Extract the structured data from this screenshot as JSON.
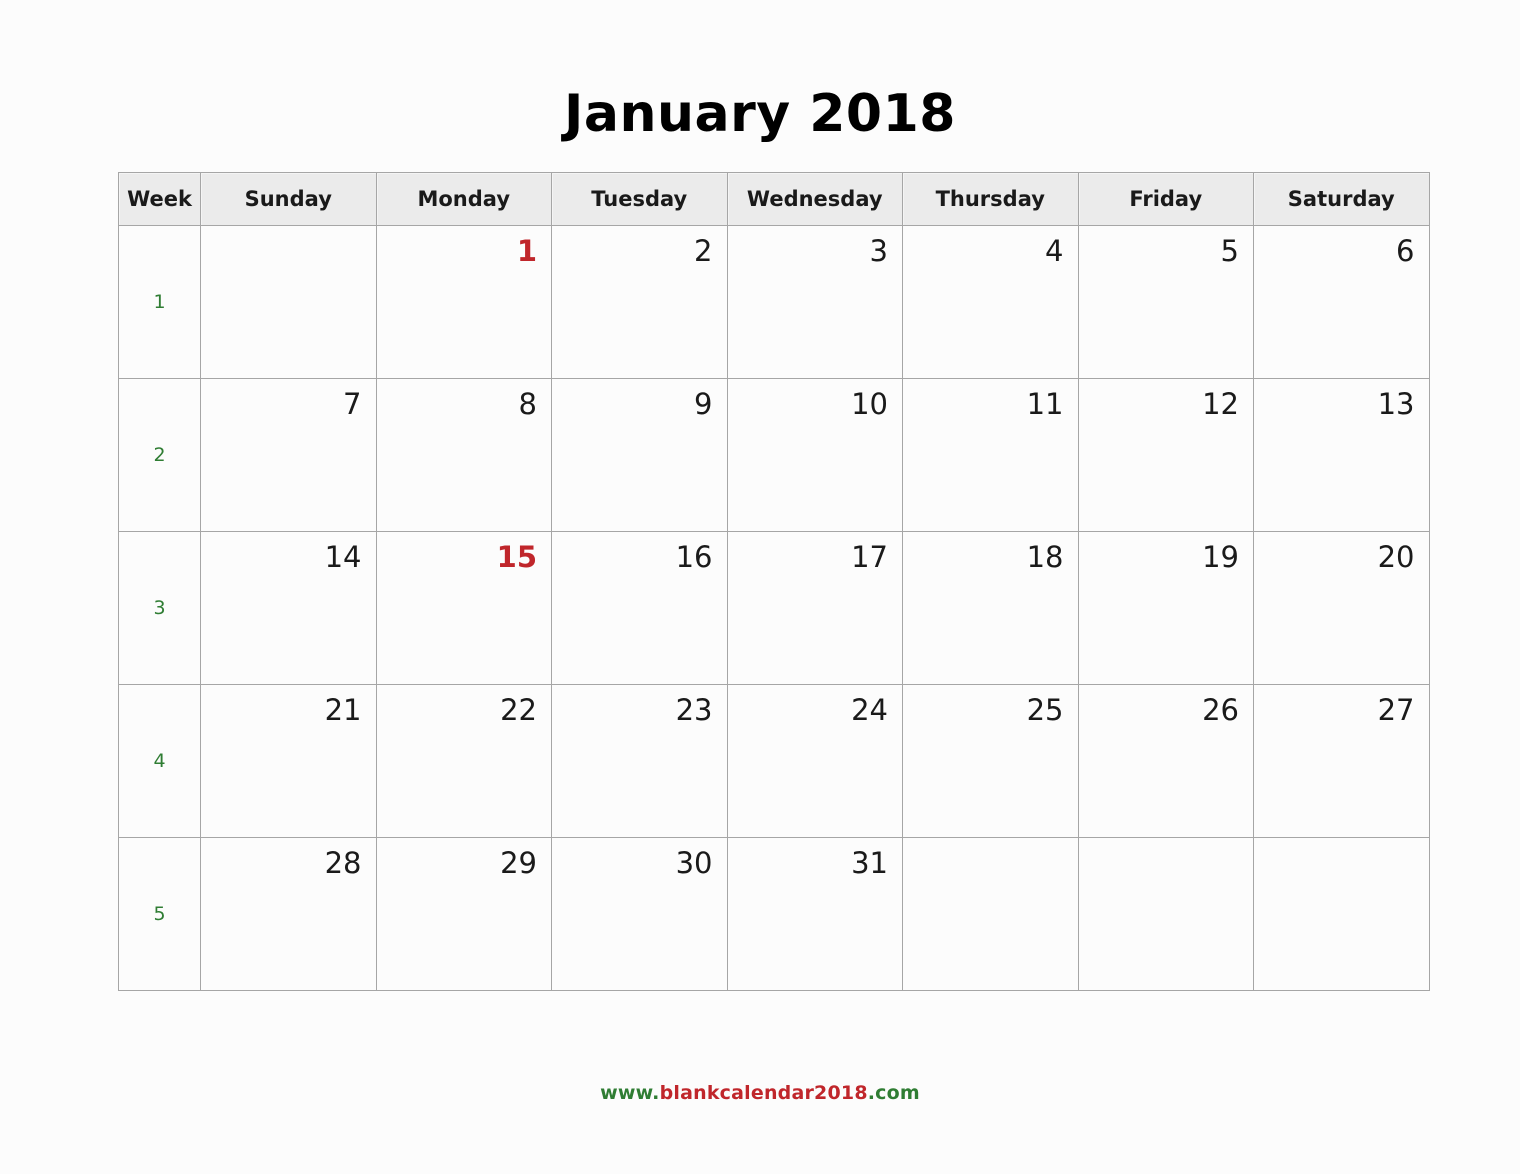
{
  "title": "January 2018",
  "colors": {
    "holiday": "#c0262b",
    "week_number": "#2f7d33",
    "header_bg": "#ebebeb",
    "border": "#a6a6a6",
    "text": "#1a1a1a"
  },
  "table": {
    "headers": [
      "Week",
      "Sunday",
      "Monday",
      "Tuesday",
      "Wednesday",
      "Thursday",
      "Friday",
      "Saturday"
    ],
    "rows": [
      {
        "week": "1",
        "days": [
          {
            "day": "",
            "holiday": false
          },
          {
            "day": "1",
            "holiday": true
          },
          {
            "day": "2",
            "holiday": false
          },
          {
            "day": "3",
            "holiday": false
          },
          {
            "day": "4",
            "holiday": false
          },
          {
            "day": "5",
            "holiday": false
          },
          {
            "day": "6",
            "holiday": false
          }
        ]
      },
      {
        "week": "2",
        "days": [
          {
            "day": "7",
            "holiday": false
          },
          {
            "day": "8",
            "holiday": false
          },
          {
            "day": "9",
            "holiday": false
          },
          {
            "day": "10",
            "holiday": false
          },
          {
            "day": "11",
            "holiday": false
          },
          {
            "day": "12",
            "holiday": false
          },
          {
            "day": "13",
            "holiday": false
          }
        ]
      },
      {
        "week": "3",
        "days": [
          {
            "day": "14",
            "holiday": false
          },
          {
            "day": "15",
            "holiday": true
          },
          {
            "day": "16",
            "holiday": false
          },
          {
            "day": "17",
            "holiday": false
          },
          {
            "day": "18",
            "holiday": false
          },
          {
            "day": "19",
            "holiday": false
          },
          {
            "day": "20",
            "holiday": false
          }
        ]
      },
      {
        "week": "4",
        "days": [
          {
            "day": "21",
            "holiday": false
          },
          {
            "day": "22",
            "holiday": false
          },
          {
            "day": "23",
            "holiday": false
          },
          {
            "day": "24",
            "holiday": false
          },
          {
            "day": "25",
            "holiday": false
          },
          {
            "day": "26",
            "holiday": false
          },
          {
            "day": "27",
            "holiday": false
          }
        ]
      },
      {
        "week": "5",
        "days": [
          {
            "day": "28",
            "holiday": false
          },
          {
            "day": "29",
            "holiday": false
          },
          {
            "day": "30",
            "holiday": false
          },
          {
            "day": "31",
            "holiday": false
          },
          {
            "day": "",
            "holiday": false
          },
          {
            "day": "",
            "holiday": false
          },
          {
            "day": "",
            "holiday": false
          }
        ]
      }
    ]
  },
  "footer": {
    "segments": [
      {
        "text": "www.",
        "color": "green"
      },
      {
        "text": "blankcalendar2018",
        "color": "red"
      },
      {
        "text": ".com",
        "color": "green"
      }
    ]
  }
}
